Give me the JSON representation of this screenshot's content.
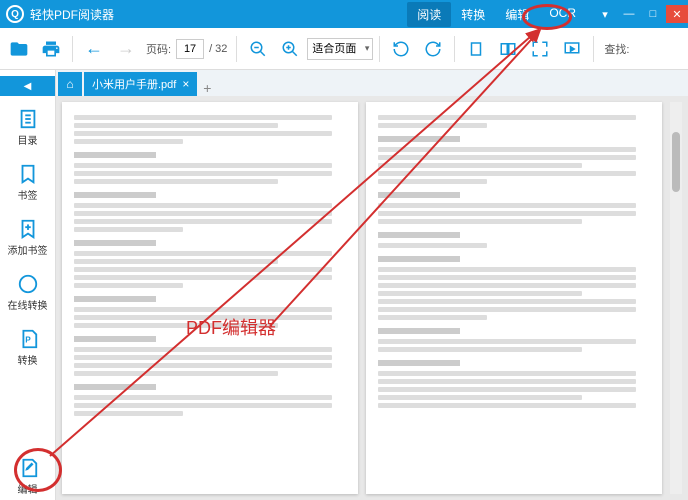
{
  "app": {
    "title": "轻快PDF阅读器"
  },
  "modes": {
    "read": "阅读",
    "convert": "转换",
    "edit": "编辑",
    "ocr": "OCR"
  },
  "toolbar": {
    "page_label": "页码:",
    "page_current": "17",
    "page_total": "/ 32",
    "zoom_mode": "适合页面",
    "find_label": "查找:"
  },
  "sidebar": {
    "toc": "目录",
    "bookmarks": "书签",
    "add_bookmark": "添加书签",
    "online_convert": "在线转换",
    "convert": "转换",
    "edit": "编辑"
  },
  "tab": {
    "filename": "小米用户手册.pdf"
  },
  "annotation": {
    "label": "PDF编辑器"
  },
  "colors": {
    "accent": "#1296db",
    "anno": "#d32f2f"
  }
}
